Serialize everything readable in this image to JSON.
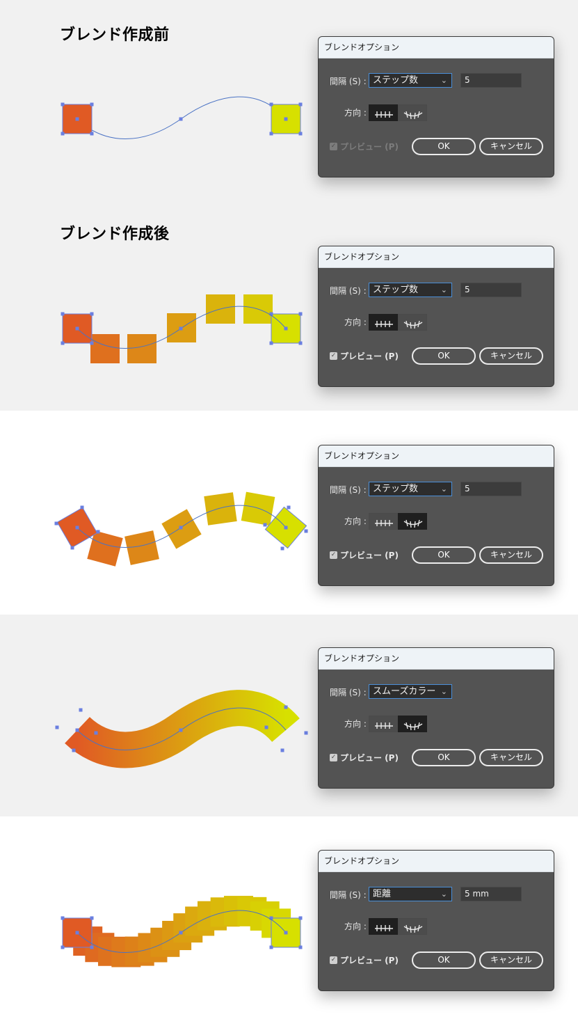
{
  "headings": [
    "ブレンド作成前",
    "ブレンド作成後"
  ],
  "dialogs": [
    {
      "title": "ブレンドオプション",
      "spacing_label": "間隔 (S) :",
      "spacing_value": "ステップ数",
      "number_value": "5",
      "orientation_label": "方向 :",
      "orientation_selected": "page",
      "preview_label": "プレビュー (P)",
      "preview_checked": false,
      "preview_enabled": false,
      "ok_label": "OK",
      "cancel_label": "キャンセル"
    },
    {
      "title": "ブレンドオプション",
      "spacing_label": "間隔 (S) :",
      "spacing_value": "ステップ数",
      "number_value": "5",
      "orientation_label": "方向 :",
      "orientation_selected": "page",
      "preview_label": "プレビュー (P)",
      "preview_checked": true,
      "preview_enabled": true,
      "ok_label": "OK",
      "cancel_label": "キャンセル"
    },
    {
      "title": "ブレンドオプション",
      "spacing_label": "間隔 (S) :",
      "spacing_value": "ステップ数",
      "number_value": "5",
      "orientation_label": "方向 :",
      "orientation_selected": "path",
      "preview_label": "プレビュー (P)",
      "preview_checked": true,
      "preview_enabled": true,
      "ok_label": "OK",
      "cancel_label": "キャンセル"
    },
    {
      "title": "ブレンドオプション",
      "spacing_label": "間隔 (S) :",
      "spacing_value": "スムーズカラー",
      "number_value": "",
      "orientation_label": "方向 :",
      "orientation_selected": "path",
      "preview_label": "プレビュー (P)",
      "preview_checked": true,
      "preview_enabled": true,
      "ok_label": "OK",
      "cancel_label": "キャンセル"
    },
    {
      "title": "ブレンドオプション",
      "spacing_label": "間隔 (S) :",
      "spacing_value": "距離",
      "number_value": "5 mm",
      "orientation_label": "方向 :",
      "orientation_selected": "page",
      "preview_label": "プレビュー (P)",
      "preview_checked": true,
      "preview_enabled": true,
      "ok_label": "OK",
      "cancel_label": "キャンセル"
    }
  ],
  "colors": {
    "start_fill": "#e05a24",
    "end_fill": "#d7e000",
    "path_stroke": "#4a72c4",
    "anchor": "#6a7fe0"
  }
}
